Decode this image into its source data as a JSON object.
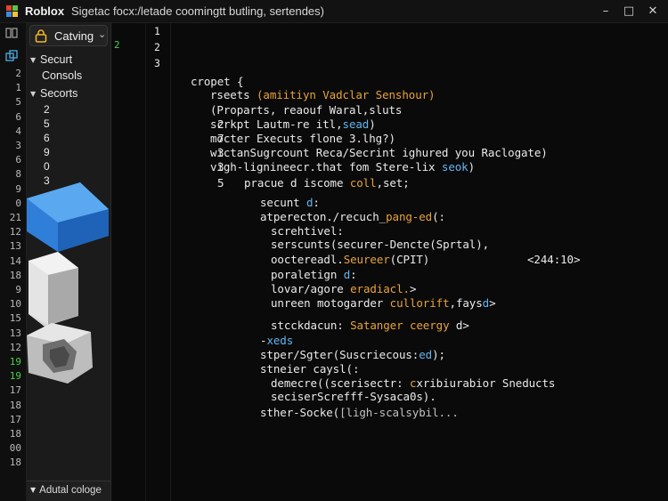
{
  "titlebar": {
    "app_name": "Roblox",
    "window_title": "Sigetac focx:/letade coomingtt butling, sertendes)",
    "minimize": "–",
    "maximize": "□",
    "close": "✕"
  },
  "gutter": {
    "line_numbers": [
      "2",
      "1",
      "5",
      "6",
      "4",
      "3",
      "6",
      "8",
      "9",
      "0",
      "21",
      "12",
      "13",
      "14",
      "18",
      "9",
      "10",
      "15",
      "13",
      "12",
      "19",
      "19",
      "17",
      "18",
      "17",
      "18",
      "00",
      "18"
    ],
    "highlighted_indexes": [
      20,
      21
    ]
  },
  "explorer": {
    "dropdown_label": "Catving",
    "rows": [
      {
        "label": "Securt",
        "expanded": true
      },
      {
        "label": "Consols",
        "expanded": false
      },
      {
        "label": "Secorts",
        "expanded": true
      }
    ],
    "numbers": [
      "2",
      "5",
      "6",
      "9",
      "0",
      "3"
    ],
    "bottom_label": "Adutal cologe"
  },
  "editor": {
    "top_line_numbers": [
      "1",
      "2",
      "3"
    ],
    "mini_line_number": "2",
    "side_line_numbers": [
      "2",
      "7",
      "3",
      "3",
      "5"
    ],
    "code_lines": [
      {
        "indent": 0,
        "segments": [
          {
            "t": "cropet {",
            "c": ""
          }
        ]
      },
      {
        "indent": 1,
        "segments": [
          {
            "t": "rseets ",
            "c": ""
          },
          {
            "t": "(amiitiyn Vadclar Senshour)",
            "c": "o"
          }
        ]
      },
      {
        "indent": 1,
        "segments": [
          {
            "t": "(Proparts, reaouf Waral,sluts",
            "c": ""
          }
        ]
      },
      {
        "indent": 2,
        "segments": [
          {
            "t": "scrkpt Lautm-re itl,",
            "c": ""
          },
          {
            "t": "sead",
            "c": "b"
          },
          {
            "t": ")",
            "c": ""
          }
        ]
      },
      {
        "indent": 2,
        "segments": [
          {
            "t": "mocter Executs flone 3.lhg?)",
            "c": ""
          }
        ]
      },
      {
        "indent": 2,
        "segments": [
          {
            "t": "wictanSugrcount Reca/Secrint ighured you Raclogate)",
            "c": ""
          }
        ]
      },
      {
        "indent": 2,
        "segments": [
          {
            "t": "vigh-lignineecr.that fom Stere-lix ",
            "c": ""
          },
          {
            "t": "seok",
            "c": "b"
          },
          {
            "t": ")",
            "c": ""
          }
        ]
      },
      {
        "indent": 3,
        "segments": [
          {
            "t": "pracue d iscome ",
            "c": ""
          },
          {
            "t": "coll",
            "c": "o"
          },
          {
            "t": ",set;",
            "c": ""
          }
        ]
      },
      {
        "indent": 4,
        "segments": [
          {
            "t": "secunt ",
            "c": ""
          },
          {
            "t": "d",
            "c": "b"
          },
          {
            "t": ":",
            "c": ""
          }
        ]
      },
      {
        "indent": 4,
        "segments": [
          {
            "t": "atperecton./recuch_",
            "c": ""
          },
          {
            "t": "pang-ed",
            "c": "o"
          },
          {
            "t": "(:",
            "c": ""
          }
        ]
      },
      {
        "indent": 5,
        "segments": [
          {
            "t": "screhtivel:",
            "c": ""
          }
        ]
      },
      {
        "indent": 5,
        "segments": [
          {
            "t": "serscunts(securer-Dencte(Sprtal),",
            "c": ""
          }
        ]
      },
      {
        "indent": 5,
        "segments": [
          {
            "t": "ooctereadl.",
            "c": ""
          },
          {
            "t": "Seureer",
            "c": "o"
          },
          {
            "t": "(CPIT)",
            "c": ""
          }
        ]
      },
      {
        "indent": 5,
        "segments": [
          {
            "t": "poraletign ",
            "c": ""
          },
          {
            "t": "d",
            "c": "b"
          },
          {
            "t": ":",
            "c": ""
          }
        ]
      },
      {
        "indent": 5,
        "segments": [
          {
            "t": "lovar/agore ",
            "c": ""
          },
          {
            "t": "eradiacl.",
            "c": "o"
          },
          {
            "t": ">",
            "c": ""
          }
        ]
      },
      {
        "indent": 5,
        "segments": [
          {
            "t": "unreen motogarder ",
            "c": ""
          },
          {
            "t": "cullorift",
            "c": "o"
          },
          {
            "t": ",fays",
            "c": ""
          },
          {
            "t": "d",
            "c": "b"
          },
          {
            "t": ">",
            "c": ""
          }
        ]
      },
      {
        "indent": 5,
        "segments": [
          {
            "t": "stcckdacun: ",
            "c": ""
          },
          {
            "t": "Satanger ceergy",
            "c": "o"
          },
          {
            "t": " d>",
            "c": ""
          }
        ]
      },
      {
        "indent": 4,
        "segments": [
          {
            "t": "-",
            "c": ""
          },
          {
            "t": "xeds",
            "c": "b"
          }
        ]
      },
      {
        "indent": 4,
        "segments": [
          {
            "t": "stper/Sgter(Suscriecous:",
            "c": ""
          },
          {
            "t": "ed",
            "c": "b"
          },
          {
            "t": ");",
            "c": ""
          }
        ]
      },
      {
        "indent": 4,
        "segments": [
          {
            "t": "stneier caysl(:",
            "c": ""
          }
        ]
      },
      {
        "indent": 5,
        "segments": [
          {
            "t": "demecre((scerisectr: ",
            "c": ""
          },
          {
            "t": "c",
            "c": "o"
          },
          {
            "t": "xribiurabior Sneducts",
            "c": ""
          }
        ]
      },
      {
        "indent": 5,
        "segments": [
          {
            "t": "seciserScrefff-Sysaca0s).",
            "c": ""
          }
        ]
      },
      {
        "indent": 4,
        "segments": [
          {
            "t": "sther-Socke(",
            "c": ""
          },
          {
            "t": "[ligh-scalsybil...",
            "c": "g"
          }
        ]
      }
    ],
    "right_annotation": "<244:10>"
  },
  "colors": {
    "accent_green": "#45d24a",
    "orange": "#e8a23c",
    "blue": "#63b5f0",
    "block_blue": "#3a8be0"
  },
  "icons": {
    "logo": "roblox-logo-icon",
    "dropdown": "lock-folder-icon",
    "gutter_top": "split-icon",
    "gutter_second": "explorer-icon"
  }
}
